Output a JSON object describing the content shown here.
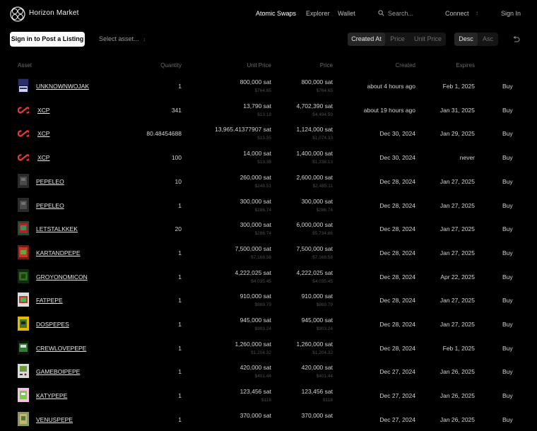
{
  "header": {
    "brand": "Horizon Market",
    "nav": [
      "Atomic Swaps",
      "Explorer",
      "Wallet"
    ],
    "search_placeholder": "Search...",
    "connect": "Connect",
    "sign_in": "Sign In"
  },
  "toolbar": {
    "post_button": "Sign in to Post a Listing",
    "asset_select": "Select asset...",
    "sort_options": [
      "Created At",
      "Price",
      "Unit Price"
    ],
    "sort_active": "Created At",
    "directions": [
      "Desc",
      "Asc"
    ],
    "direction_active": "Desc"
  },
  "table": {
    "columns": [
      "Asset",
      "Quantity",
      "Unit Price",
      "Price",
      "Created",
      "Expires"
    ],
    "rows": [
      {
        "asset": "UNKNOWNWOJAK",
        "thumb": "wojak",
        "quantity": "1",
        "unit_price": "800,000 sat",
        "unit_price_usd": "$764.65",
        "price": "800,000 sat",
        "price_usd": "$764.65",
        "created": "about 4 hours ago",
        "expires": "Feb 1, 2025",
        "action": "Buy"
      },
      {
        "asset": "XCP",
        "thumb": "xcp",
        "quantity": "341",
        "unit_price": "13,790 sat",
        "unit_price_usd": "$13.18",
        "price": "4,702,390 sat",
        "price_usd": "$4,494.59",
        "created": "about 19 hours ago",
        "expires": "Jan 31, 2025",
        "action": "Buy"
      },
      {
        "asset": "XCP",
        "thumb": "xcp",
        "quantity": "80.48454688",
        "unit_price": "13,965.41377907 sat",
        "unit_price_usd": "$13.35",
        "price": "1,124,000 sat",
        "price_usd": "$1,074.33",
        "created": "Dec 30, 2024",
        "expires": "Jan 29, 2025",
        "action": "Buy"
      },
      {
        "asset": "XCP",
        "thumb": "xcp",
        "quantity": "100",
        "unit_price": "14,000 sat",
        "unit_price_usd": "$13.38",
        "price": "1,400,000 sat",
        "price_usd": "$1,338.13",
        "created": "Dec 30, 2024",
        "expires": "never",
        "action": "Buy"
      },
      {
        "asset": "PEPELEO",
        "thumb": "dark",
        "quantity": "10",
        "unit_price": "260,000 sat",
        "unit_price_usd": "$248.51",
        "price": "2,600,000 sat",
        "price_usd": "$2,485.11",
        "created": "Dec 28, 2024",
        "expires": "Jan 27, 2025",
        "action": "Buy"
      },
      {
        "asset": "PEPELEO",
        "thumb": "dark",
        "quantity": "1",
        "unit_price": "300,000 sat",
        "unit_price_usd": "$286.74",
        "price": "300,000 sat",
        "price_usd": "$286.74",
        "created": "Dec 28, 2024",
        "expires": "Jan 27, 2025",
        "action": "Buy"
      },
      {
        "asset": "LETSTALKKEK",
        "thumb": "kek",
        "quantity": "20",
        "unit_price": "300,000 sat",
        "unit_price_usd": "$286.74",
        "price": "6,000,000 sat",
        "price_usd": "$5,734.86",
        "created": "Dec 28, 2024",
        "expires": "Jan 27, 2025",
        "action": "Buy"
      },
      {
        "asset": "KARTANDPEPE",
        "thumb": "kart",
        "quantity": "1",
        "unit_price": "7,500,000 sat",
        "unit_price_usd": "$7,168.58",
        "price": "7,500,000 sat",
        "price_usd": "$7,168.58",
        "created": "Dec 28, 2024",
        "expires": "Jan 27, 2025",
        "action": "Buy"
      },
      {
        "asset": "GROYONOMICON",
        "thumb": "groy",
        "quantity": "1",
        "unit_price": "4,222,025 sat",
        "unit_price_usd": "$4,035.45",
        "price": "4,222,025 sat",
        "price_usd": "$4,035.45",
        "created": "Dec 28, 2024",
        "expires": "Apr 22, 2025",
        "action": "Buy"
      },
      {
        "asset": "FATPEPE",
        "thumb": "fat",
        "quantity": "1",
        "unit_price": "910,000 sat",
        "unit_price_usd": "$869.79",
        "price": "910,000 sat",
        "price_usd": "$869.79",
        "created": "Dec 28, 2024",
        "expires": "Jan 27, 2025",
        "action": "Buy"
      },
      {
        "asset": "DOSPEPES",
        "thumb": "dos",
        "quantity": "1",
        "unit_price": "945,000 sat",
        "unit_price_usd": "$903.24",
        "price": "945,000 sat",
        "price_usd": "$903.24",
        "created": "Dec 28, 2024",
        "expires": "Jan 27, 2025",
        "action": "Buy"
      },
      {
        "asset": "CREWLOVEPEPE",
        "thumb": "crew",
        "quantity": "1",
        "unit_price": "1,260,000 sat",
        "unit_price_usd": "$1,204.32",
        "price": "1,260,000 sat",
        "price_usd": "$1,204.32",
        "created": "Dec 28, 2024",
        "expires": "Feb 1, 2025",
        "action": "Buy"
      },
      {
        "asset": "GAMEBOIPEPE",
        "thumb": "gameboi",
        "quantity": "1",
        "unit_price": "420,000 sat",
        "unit_price_usd": "$401.44",
        "price": "420,000 sat",
        "price_usd": "$401.44",
        "created": "Dec 27, 2024",
        "expires": "Jan 26, 2025",
        "action": "Buy"
      },
      {
        "asset": "KATYPEPE",
        "thumb": "katy",
        "quantity": "1",
        "unit_price": "123,456 sat",
        "unit_price_usd": "$118",
        "price": "123,456 sat",
        "price_usd": "$118",
        "created": "Dec 27, 2024",
        "expires": "Jan 26, 2025",
        "action": "Buy"
      },
      {
        "asset": "VENUSPEPE",
        "thumb": "venus",
        "quantity": "1",
        "unit_price": "370,000 sat",
        "unit_price_usd": "",
        "price": "370,000 sat",
        "price_usd": "",
        "created": "Dec 27, 2024",
        "expires": "Jan 26, 2025",
        "action": "Buy"
      }
    ]
  }
}
